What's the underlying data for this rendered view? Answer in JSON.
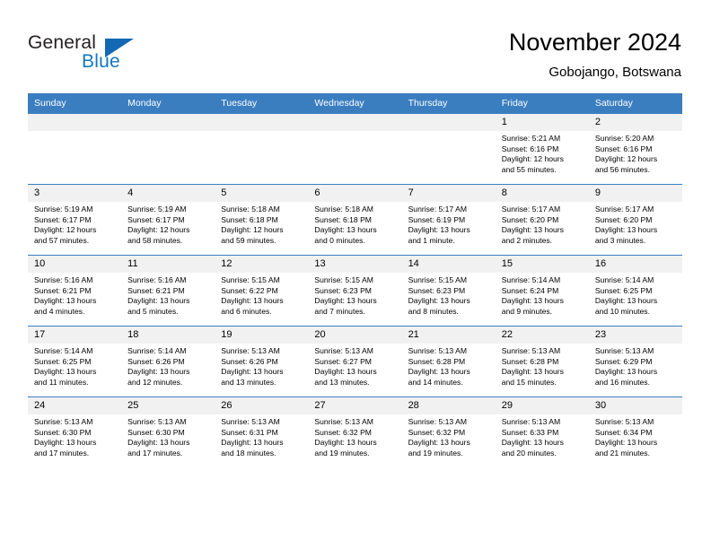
{
  "brand": {
    "name_part1": "General",
    "name_part2": "Blue"
  },
  "header": {
    "title": "November 2024",
    "location": "Gobojango, Botswana"
  },
  "colors": {
    "header_blue": "#3b7ec0",
    "logo_blue": "#1278be",
    "daynum_bg": "#f1f1f1",
    "text": "#000000"
  },
  "weekdays": [
    "Sunday",
    "Monday",
    "Tuesday",
    "Wednesday",
    "Thursday",
    "Friday",
    "Saturday"
  ],
  "labels": {
    "sunrise_prefix": "Sunrise:",
    "sunset_prefix": "Sunset:",
    "daylight_prefix": "Daylight:"
  },
  "weeks": [
    [
      {
        "day": "",
        "blank": true,
        "line1": "",
        "line2": "",
        "line3": "",
        "line4": ""
      },
      {
        "day": "",
        "blank": true,
        "line1": "",
        "line2": "",
        "line3": "",
        "line4": ""
      },
      {
        "day": "",
        "blank": true,
        "line1": "",
        "line2": "",
        "line3": "",
        "line4": ""
      },
      {
        "day": "",
        "blank": true,
        "line1": "",
        "line2": "",
        "line3": "",
        "line4": ""
      },
      {
        "day": "",
        "blank": true,
        "line1": "",
        "line2": "",
        "line3": "",
        "line4": ""
      },
      {
        "day": "1",
        "blank": false,
        "line1": "Sunrise: 5:21 AM",
        "line2": "Sunset: 6:16 PM",
        "line3": "Daylight: 12 hours",
        "line4": "and 55 minutes."
      },
      {
        "day": "2",
        "blank": false,
        "line1": "Sunrise: 5:20 AM",
        "line2": "Sunset: 6:16 PM",
        "line3": "Daylight: 12 hours",
        "line4": "and 56 minutes."
      }
    ],
    [
      {
        "day": "3",
        "blank": false,
        "line1": "Sunrise: 5:19 AM",
        "line2": "Sunset: 6:17 PM",
        "line3": "Daylight: 12 hours",
        "line4": "and 57 minutes."
      },
      {
        "day": "4",
        "blank": false,
        "line1": "Sunrise: 5:19 AM",
        "line2": "Sunset: 6:17 PM",
        "line3": "Daylight: 12 hours",
        "line4": "and 58 minutes."
      },
      {
        "day": "5",
        "blank": false,
        "line1": "Sunrise: 5:18 AM",
        "line2": "Sunset: 6:18 PM",
        "line3": "Daylight: 12 hours",
        "line4": "and 59 minutes."
      },
      {
        "day": "6",
        "blank": false,
        "line1": "Sunrise: 5:18 AM",
        "line2": "Sunset: 6:18 PM",
        "line3": "Daylight: 13 hours",
        "line4": "and 0 minutes."
      },
      {
        "day": "7",
        "blank": false,
        "line1": "Sunrise: 5:17 AM",
        "line2": "Sunset: 6:19 PM",
        "line3": "Daylight: 13 hours",
        "line4": "and 1 minute."
      },
      {
        "day": "8",
        "blank": false,
        "line1": "Sunrise: 5:17 AM",
        "line2": "Sunset: 6:20 PM",
        "line3": "Daylight: 13 hours",
        "line4": "and 2 minutes."
      },
      {
        "day": "9",
        "blank": false,
        "line1": "Sunrise: 5:17 AM",
        "line2": "Sunset: 6:20 PM",
        "line3": "Daylight: 13 hours",
        "line4": "and 3 minutes."
      }
    ],
    [
      {
        "day": "10",
        "blank": false,
        "line1": "Sunrise: 5:16 AM",
        "line2": "Sunset: 6:21 PM",
        "line3": "Daylight: 13 hours",
        "line4": "and 4 minutes."
      },
      {
        "day": "11",
        "blank": false,
        "line1": "Sunrise: 5:16 AM",
        "line2": "Sunset: 6:21 PM",
        "line3": "Daylight: 13 hours",
        "line4": "and 5 minutes."
      },
      {
        "day": "12",
        "blank": false,
        "line1": "Sunrise: 5:15 AM",
        "line2": "Sunset: 6:22 PM",
        "line3": "Daylight: 13 hours",
        "line4": "and 6 minutes."
      },
      {
        "day": "13",
        "blank": false,
        "line1": "Sunrise: 5:15 AM",
        "line2": "Sunset: 6:23 PM",
        "line3": "Daylight: 13 hours",
        "line4": "and 7 minutes."
      },
      {
        "day": "14",
        "blank": false,
        "line1": "Sunrise: 5:15 AM",
        "line2": "Sunset: 6:23 PM",
        "line3": "Daylight: 13 hours",
        "line4": "and 8 minutes."
      },
      {
        "day": "15",
        "blank": false,
        "line1": "Sunrise: 5:14 AM",
        "line2": "Sunset: 6:24 PM",
        "line3": "Daylight: 13 hours",
        "line4": "and 9 minutes."
      },
      {
        "day": "16",
        "blank": false,
        "line1": "Sunrise: 5:14 AM",
        "line2": "Sunset: 6:25 PM",
        "line3": "Daylight: 13 hours",
        "line4": "and 10 minutes."
      }
    ],
    [
      {
        "day": "17",
        "blank": false,
        "line1": "Sunrise: 5:14 AM",
        "line2": "Sunset: 6:25 PM",
        "line3": "Daylight: 13 hours",
        "line4": "and 11 minutes."
      },
      {
        "day": "18",
        "blank": false,
        "line1": "Sunrise: 5:14 AM",
        "line2": "Sunset: 6:26 PM",
        "line3": "Daylight: 13 hours",
        "line4": "and 12 minutes."
      },
      {
        "day": "19",
        "blank": false,
        "line1": "Sunrise: 5:13 AM",
        "line2": "Sunset: 6:26 PM",
        "line3": "Daylight: 13 hours",
        "line4": "and 13 minutes."
      },
      {
        "day": "20",
        "blank": false,
        "line1": "Sunrise: 5:13 AM",
        "line2": "Sunset: 6:27 PM",
        "line3": "Daylight: 13 hours",
        "line4": "and 13 minutes."
      },
      {
        "day": "21",
        "blank": false,
        "line1": "Sunrise: 5:13 AM",
        "line2": "Sunset: 6:28 PM",
        "line3": "Daylight: 13 hours",
        "line4": "and 14 minutes."
      },
      {
        "day": "22",
        "blank": false,
        "line1": "Sunrise: 5:13 AM",
        "line2": "Sunset: 6:28 PM",
        "line3": "Daylight: 13 hours",
        "line4": "and 15 minutes."
      },
      {
        "day": "23",
        "blank": false,
        "line1": "Sunrise: 5:13 AM",
        "line2": "Sunset: 6:29 PM",
        "line3": "Daylight: 13 hours",
        "line4": "and 16 minutes."
      }
    ],
    [
      {
        "day": "24",
        "blank": false,
        "line1": "Sunrise: 5:13 AM",
        "line2": "Sunset: 6:30 PM",
        "line3": "Daylight: 13 hours",
        "line4": "and 17 minutes."
      },
      {
        "day": "25",
        "blank": false,
        "line1": "Sunrise: 5:13 AM",
        "line2": "Sunset: 6:30 PM",
        "line3": "Daylight: 13 hours",
        "line4": "and 17 minutes."
      },
      {
        "day": "26",
        "blank": false,
        "line1": "Sunrise: 5:13 AM",
        "line2": "Sunset: 6:31 PM",
        "line3": "Daylight: 13 hours",
        "line4": "and 18 minutes."
      },
      {
        "day": "27",
        "blank": false,
        "line1": "Sunrise: 5:13 AM",
        "line2": "Sunset: 6:32 PM",
        "line3": "Daylight: 13 hours",
        "line4": "and 19 minutes."
      },
      {
        "day": "28",
        "blank": false,
        "line1": "Sunrise: 5:13 AM",
        "line2": "Sunset: 6:32 PM",
        "line3": "Daylight: 13 hours",
        "line4": "and 19 minutes."
      },
      {
        "day": "29",
        "blank": false,
        "line1": "Sunrise: 5:13 AM",
        "line2": "Sunset: 6:33 PM",
        "line3": "Daylight: 13 hours",
        "line4": "and 20 minutes."
      },
      {
        "day": "30",
        "blank": false,
        "line1": "Sunrise: 5:13 AM",
        "line2": "Sunset: 6:34 PM",
        "line3": "Daylight: 13 hours",
        "line4": "and 21 minutes."
      }
    ]
  ]
}
